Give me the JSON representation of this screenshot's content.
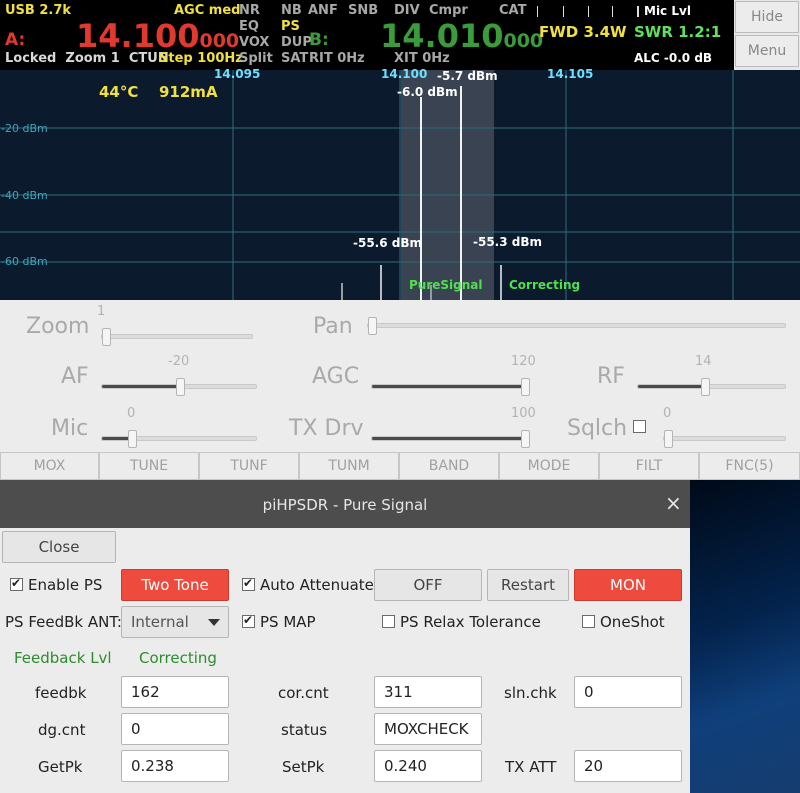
{
  "vfo": {
    "mode": "USB 2.7k",
    "agc": "AGC med",
    "vfo_a_label": "A:",
    "vfo_a_main": "14.100",
    "vfo_a_sub": "000",
    "vfo_a_info": "Locked  Zoom 1  CTUN",
    "step": "Step 100Hz",
    "nr": "NR",
    "eq": "EQ",
    "vox": "VOX",
    "split": "Split",
    "nb": "NB",
    "ps": "PS",
    "dup": "DUP",
    "sat": "SAT",
    "anf": "ANF",
    "snb": "SNB",
    "rit": "RIT 0Hz",
    "vfo_b_label": "B:",
    "vfo_b_main": "14.010",
    "vfo_b_sub": "000",
    "div": "DIV",
    "cmpr": "Cmpr",
    "xit": "XIT 0Hz",
    "cat": "CAT",
    "fwd": "FWD 3.4W",
    "swr": "SWR 1.2:1",
    "mic_lvl": "Mic Lvl",
    "alc": "ALC -0.0 dB"
  },
  "side_buttons": {
    "hide": "Hide",
    "menu": "Menu"
  },
  "panadapter": {
    "freq_labels": [
      "14.095",
      "14.100",
      "14.105"
    ],
    "db_labels": [
      "-20 dBm",
      "-40 dBm",
      "-60 dBm"
    ],
    "temp": "44°C",
    "current": "912mA",
    "peak_main_right": "-5.7 dBm",
    "peak_main_left": "-6.0 dBm",
    "imd_left": "-55.6 dBm",
    "imd_right": "-55.3 dBm",
    "puresignal_label": "PureSignal",
    "correcting_label": "Correcting"
  },
  "sliders": {
    "zoom": {
      "label": "Zoom",
      "value": "1",
      "fraction": 0.0
    },
    "pan": {
      "label": "Pan",
      "fraction": 0.0
    },
    "af": {
      "label": "AF",
      "value": "-20",
      "fraction": 0.5
    },
    "agc": {
      "label": "AGC",
      "value": "120",
      "fraction": 1.0
    },
    "rf": {
      "label": "RF",
      "value": "14",
      "fraction": 0.45
    },
    "mic": {
      "label": "Mic",
      "value": "0",
      "fraction": 0.18
    },
    "txdrv": {
      "label": "TX Drv",
      "value": "100",
      "fraction": 1.0
    },
    "sqlch": {
      "label": "Sqlch",
      "value": "0",
      "fraction": 0.0
    }
  },
  "function_keys": [
    "MOX",
    "TUNE",
    "TUNF",
    "TUNM",
    "BAND",
    "MODE",
    "FILT",
    "FNC(5)"
  ],
  "dialog": {
    "title": "piHPSDR - Pure Signal",
    "close_icon": "×",
    "close_button": "Close",
    "enable_ps": "Enable PS",
    "two_tone": "Two Tone",
    "auto_attenuate": "Auto Attenuate",
    "off": "OFF",
    "restart": "Restart",
    "mon": "MON",
    "feedbk_ant_label": "PS FeedBk ANT:",
    "feedbk_ant_value": "Internal",
    "ps_map": "PS MAP",
    "ps_relax": "PS Relax Tolerance",
    "oneshot": "OneShot",
    "feedback_lvl": "Feedback Lvl",
    "correcting": "Correcting",
    "fields": {
      "feedbk_label": "feedbk",
      "feedbk_value": "162",
      "corcnt_label": "cor.cnt",
      "corcnt_value": "311",
      "slnchk_label": "sln.chk",
      "slnchk_value": "0",
      "dgcnt_label": "dg.cnt",
      "dgcnt_value": "0",
      "status_label": "status",
      "status_value": "MOXCHECK",
      "getpk_label": "GetPk",
      "getpk_value": "0.238",
      "setpk_label": "SetPk",
      "setpk_value": "0.240",
      "txatt_label": "TX ATT",
      "txatt_value": "20"
    }
  }
}
